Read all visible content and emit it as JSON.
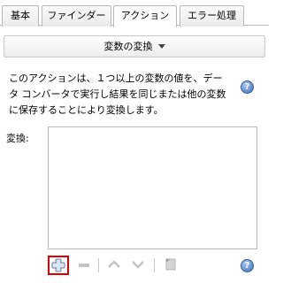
{
  "tabs": [
    {
      "label": "基本",
      "active": false
    },
    {
      "label": "ファインダー",
      "active": false
    },
    {
      "label": "アクション",
      "active": true
    },
    {
      "label": "エラー処理",
      "active": false
    }
  ],
  "function_dropdown": {
    "selected": "変数の変換"
  },
  "description": "このアクションは、１つ以上の変数の値を、データ コンバータで実行し結果を同じまたは他の変数に保存することにより変換します。",
  "conversion": {
    "label": "変換:",
    "items": []
  },
  "toolbar": {
    "buttons": [
      {
        "name": "add",
        "icon": "plus-icon",
        "enabled": true
      },
      {
        "name": "remove",
        "icon": "minus-icon",
        "enabled": false
      },
      {
        "name": "move-up",
        "icon": "chevron-up-icon",
        "enabled": false
      },
      {
        "name": "move-down",
        "icon": "chevron-down-icon",
        "enabled": false
      },
      {
        "name": "edit",
        "icon": "edit-icon",
        "enabled": false
      }
    ]
  },
  "colors": {
    "accent": "#3d6fb8",
    "highlight_border": "#dc0000",
    "border": "#b9b9b9"
  }
}
